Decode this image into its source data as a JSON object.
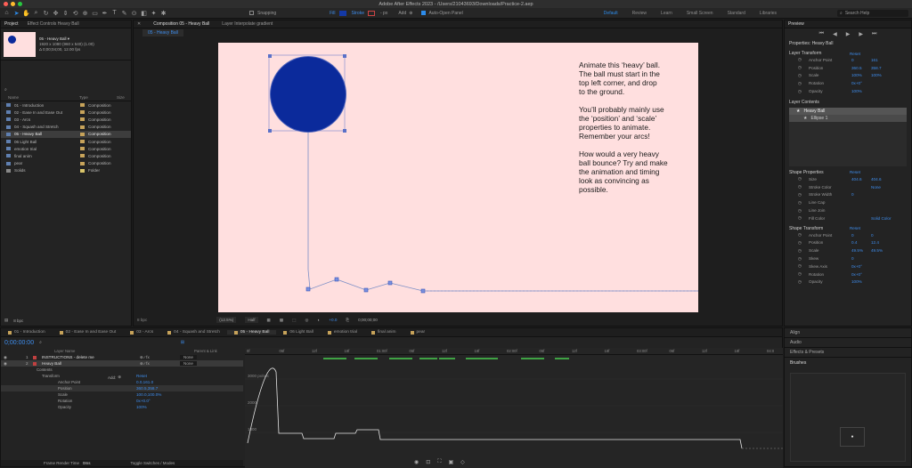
{
  "app": {
    "title": "Adobe After Effects 2023 - /Users/21043693/Downloads/Practice-2.aep"
  },
  "toolbar": {
    "snapping": "Snapping",
    "fill": "Fill",
    "stroke": "Stroke",
    "px": "- px",
    "add": "Add",
    "auto_open": "Auto-Open Panel",
    "search": "Search Help",
    "workspaces": [
      "Default",
      "Review",
      "Learn",
      "Small Screen",
      "Standard",
      "Libraries"
    ]
  },
  "project": {
    "tab": "Project",
    "effect_tab": "Effect Controls Heavy Ball",
    "item_name": "05 - Heavy Ball ▾",
    "item_info1": "1920 x 1080 (960 x 540) (1.00)",
    "item_info2": "Δ 0;00;04;00, 12.00 fps",
    "col_name": "Name",
    "col_type": "Type",
    "col_size": "Size",
    "items": [
      {
        "name": "01 - Introduction",
        "type": "Composition",
        "color": "#c7a35a"
      },
      {
        "name": "02 - Ease In and Ease Out",
        "type": "Composition",
        "color": "#c7a35a"
      },
      {
        "name": "03 - Arcs",
        "type": "Composition",
        "color": "#c7a35a"
      },
      {
        "name": "04 - Squash and Stretch",
        "type": "Composition",
        "color": "#c7a35a"
      },
      {
        "name": "05 - Heavy Ball",
        "type": "Composition",
        "color": "#c7a35a"
      },
      {
        "name": "06 Light Ball",
        "type": "Composition",
        "color": "#c7a35a"
      },
      {
        "name": "emotion trial",
        "type": "Composition",
        "color": "#c7a35a"
      },
      {
        "name": "final anim",
        "type": "Composition",
        "color": "#c7a35a"
      },
      {
        "name": "pear",
        "type": "Composition",
        "color": "#c7a35a"
      },
      {
        "name": "Solids",
        "type": "Folder",
        "color": "#d9c46a"
      }
    ],
    "bpc": "8 bpc"
  },
  "comp": {
    "tab": "Composition 05 - Heavy Ball",
    "layer_tab": "Layer Interpolate gradient",
    "subtab": "05 - Heavy Ball",
    "bg": "#ffdfdf",
    "ball_color": "#0b2a9b",
    "text": [
      "Animate this ‘heavy’ ball.",
      "The ball must start in the",
      "top left corner, and drop",
      "to the ground.",
      "",
      "You’ll probably mainly use",
      "the ‘position’ and ‘scale’",
      "properties to animate.",
      "Remember your arcs!",
      "",
      "How would a very heavy",
      "ball bounce? Try and make",
      "the animation and timing",
      "look as convincing as",
      "possible."
    ],
    "zoom": "(12.5%)",
    "resolution": "Half",
    "exposure": "+0.0",
    "timecode": "0;00;00;00"
  },
  "props": {
    "title": "Properties: Heavy Ball",
    "preview": "Preview",
    "layer_transform": "Layer Transform",
    "reset": "Reset",
    "lt": [
      {
        "k": "Anchor Point",
        "a": "0",
        "b": "161"
      },
      {
        "k": "Position",
        "a": "360.5",
        "b": "358.7"
      },
      {
        "k": "Scale",
        "a": "100%",
        "b": "100%"
      },
      {
        "k": "Rotation",
        "a": "0x+0°",
        "b": ""
      },
      {
        "k": "Opacity",
        "a": "100%",
        "b": ""
      }
    ],
    "layer_contents": "Layer Contents",
    "contents": [
      "Heavy Ball",
      "Ellipse 1"
    ],
    "shape_props": "Shape Properties",
    "sp": [
      {
        "k": "Size",
        "a": "404.6",
        "b": "404.6"
      },
      {
        "k": "Stroke Color",
        "a": "",
        "b": "None"
      },
      {
        "k": "Stroke Width",
        "a": "0",
        "b": ""
      },
      {
        "k": "Line Cap",
        "a": "",
        "b": ""
      },
      {
        "k": "Line Join",
        "a": "",
        "b": ""
      },
      {
        "k": "Fill Color",
        "a": "",
        "b": "Solid Color"
      }
    ],
    "shape_transform": "Shape Transform",
    "st": [
      {
        "k": "Anchor Point",
        "a": "0",
        "b": "0"
      },
      {
        "k": "Position",
        "a": "0.4",
        "b": "12.4"
      },
      {
        "k": "Scale",
        "a": "49.5%",
        "b": "49.5%"
      },
      {
        "k": "Skew",
        "a": "0",
        "b": ""
      },
      {
        "k": "Skew Axis",
        "a": "0x+0°",
        "b": ""
      },
      {
        "k": "Rotation",
        "a": "0x+0°",
        "b": ""
      },
      {
        "k": "Opacity",
        "a": "100%",
        "b": ""
      }
    ],
    "align": "Align",
    "audio": "Audio",
    "effects": "Effects & Presets",
    "brushes": "Brushes"
  },
  "timeline": {
    "tabs": [
      "01 - Introduction",
      "02 - Ease In and Ease Out",
      "03 - Arcs",
      "04 - Squash and Stretch",
      "05 - Heavy Ball",
      "06 Light Ball",
      "emotion trial",
      "final anim",
      "pear"
    ],
    "active": 4,
    "timecode": "0;00:00:00",
    "col_layer": "Layer Name",
    "col_parent": "Parent & Link",
    "layers": [
      {
        "n": "1",
        "name": "INSTRUCTIONS - delete me",
        "parent": "None"
      },
      {
        "n": "2",
        "name": "Heavy Ball",
        "parent": "None"
      }
    ],
    "sub": [
      {
        "k": "Contents",
        "v": ""
      },
      {
        "k": "Transform",
        "v": "Reset"
      },
      {
        "k": "Anchor Point",
        "v": "0.0,161.0"
      },
      {
        "k": "Position",
        "v": "360.5,358.7"
      },
      {
        "k": "Scale",
        "v": "100.0,100.0%"
      },
      {
        "k": "Rotation",
        "v": "0x+0.0°"
      },
      {
        "k": "Opacity",
        "v": "100%"
      }
    ],
    "add": "Add:",
    "graph_y": [
      "3000 px/sec",
      "2000",
      "1000"
    ],
    "ruler": [
      "0f",
      "06f",
      "12f",
      "18f",
      "01:00f",
      "06f",
      "12f",
      "18f",
      "02:00f",
      "06f",
      "12f",
      "18f",
      "03:00f",
      "06f",
      "12f",
      "18f",
      "04:0"
    ],
    "footer_left": "Frame Render Time",
    "footer_time": "0ms",
    "footer_mid": "Toggle Switches / Modes"
  }
}
